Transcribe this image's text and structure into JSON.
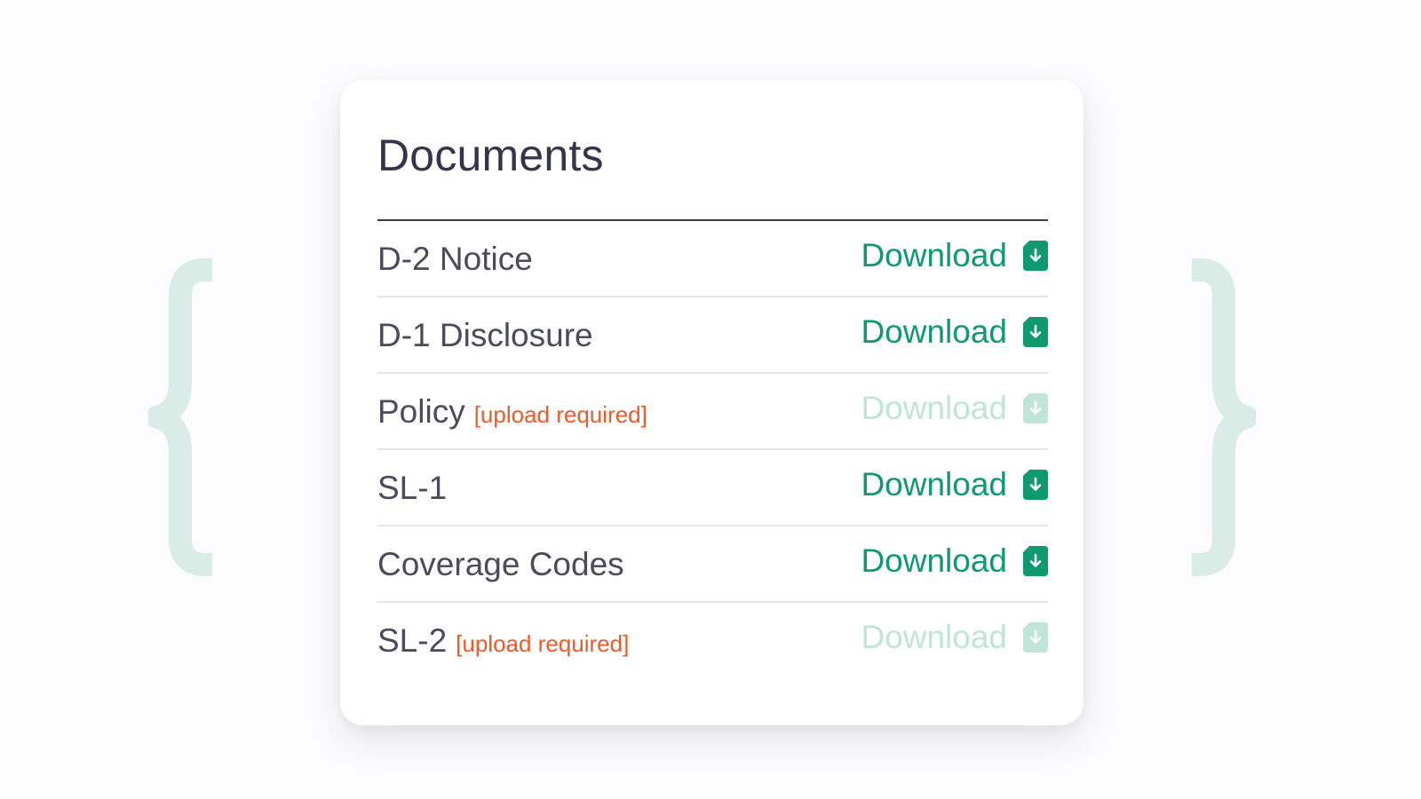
{
  "card": {
    "title": "Documents"
  },
  "documents": [
    {
      "name": "D-2 Notice",
      "flag": "",
      "action": "Download",
      "enabled": true
    },
    {
      "name": "D-1 Disclosure",
      "flag": "",
      "action": "Download",
      "enabled": true
    },
    {
      "name": "Policy",
      "flag": "[upload required]",
      "action": "Download",
      "enabled": false
    },
    {
      "name": "SL-1",
      "flag": "",
      "action": "Download",
      "enabled": true
    },
    {
      "name": "Coverage Codes",
      "flag": "",
      "action": "Download",
      "enabled": true
    },
    {
      "name": "SL-2",
      "flag": "[upload required]",
      "action": "Download",
      "enabled": false
    }
  ],
  "icons": {
    "row_action": "file-download-icon",
    "decoration_left": "left-curly-brace-icon",
    "decoration_right": "right-curly-brace-icon"
  },
  "colors": {
    "accent": "#0f9a6e",
    "accent_disabled": "#bfe4d8",
    "warning": "#ef5a2a",
    "brace": "#d9ede6"
  }
}
